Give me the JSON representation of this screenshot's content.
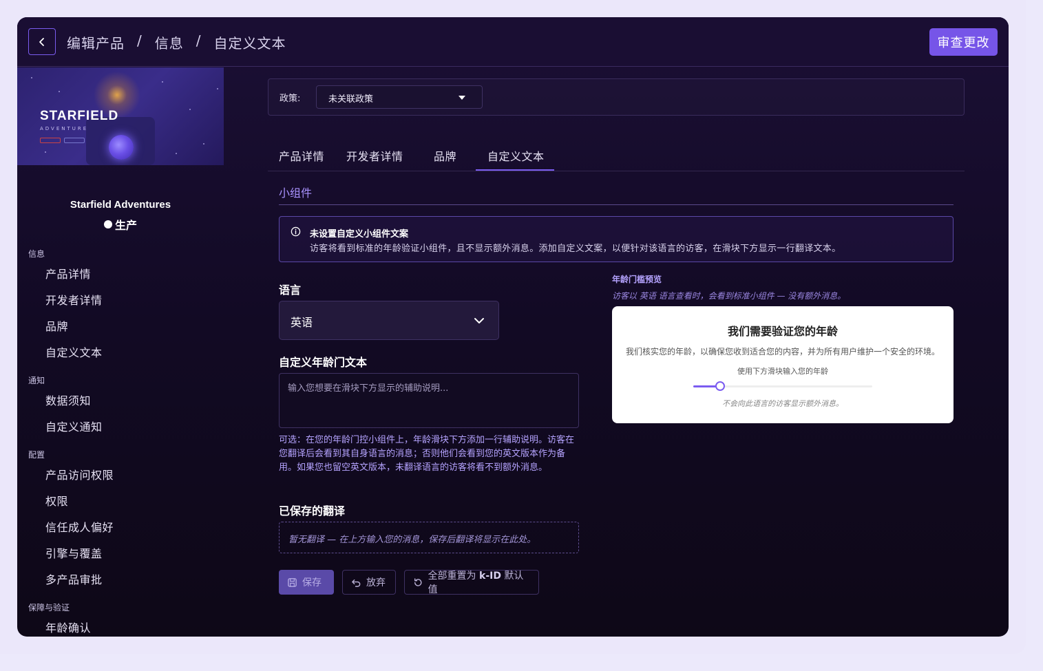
{
  "header": {
    "breadcrumb": [
      "编辑产品",
      "信息",
      "自定义文本"
    ],
    "separator": "/",
    "review_button": "审查更改"
  },
  "sidebar": {
    "thumbnail": {
      "title": "STARFIELD",
      "subtitle": "ADVENTURE"
    },
    "product_name": "Starfield Adventures",
    "product_status": "生产",
    "sections": [
      {
        "label": "信息",
        "items": [
          "产品详情",
          "开发者详情",
          "品牌",
          "自定义文本"
        ]
      },
      {
        "label": "通知",
        "items": [
          "数据须知",
          "自定义通知"
        ]
      },
      {
        "label": "配置",
        "items": [
          "产品访问权限",
          "权限",
          "信任成人偏好",
          "引擎与覆盖",
          "多产品审批"
        ]
      },
      {
        "label": "保障与验证",
        "items": [
          "年龄确认"
        ]
      }
    ]
  },
  "policy": {
    "label": "政策:",
    "value": "未关联政策"
  },
  "tabs": [
    "产品详情",
    "开发者详情",
    "品牌",
    "自定义文本"
  ],
  "active_tab": "自定义文本",
  "section_title": "小组件",
  "info": {
    "title": "未设置自定义小组件文案",
    "text": "访客将看到标准的年龄验证小组件，且不显示额外消息。添加自定义文案，以便针对该语言的访客，在滑块下方显示一行翻译文本。"
  },
  "language": {
    "label": "语言",
    "value": "英语"
  },
  "custom_text": {
    "label": "自定义年龄门文本",
    "placeholder": "输入您想要在滑块下方显示的辅助说明...",
    "helper": "可选：在您的年龄门控小组件上，年龄滑块下方添加一行辅助说明。访客在您翻译后会看到其自身语言的消息；否则他们会看到您的英文版本作为备用。如果您也留空英文版本，未翻译语言的访客将看不到额外消息。"
  },
  "saved": {
    "label": "已保存的翻译",
    "empty": "暂无翻译 — 在上方输入您的消息，保存后翻译将显示在此处。"
  },
  "buttons": {
    "save": "保存",
    "discard": "放弃",
    "reset_prefix": "全部重置为",
    "reset_brand": "k-ID",
    "reset_suffix": "默认值"
  },
  "preview": {
    "label": "年龄门槛预览",
    "subtitle": "访客以 英语 语言查看时，会看到标准小组件 — 没有额外消息。",
    "title": "我们需要验证您的年龄",
    "text": "我们核实您的年龄，以确保您收到适合您的内容，并为所有用户维护一个安全的环境。",
    "hint": "使用下方滑块输入您的年龄",
    "note": "不会向此语言的访客显示额外消息。",
    "slider_fraction": 0.15
  },
  "colors": {
    "accent": "#7655e8",
    "background": "#140b28"
  }
}
